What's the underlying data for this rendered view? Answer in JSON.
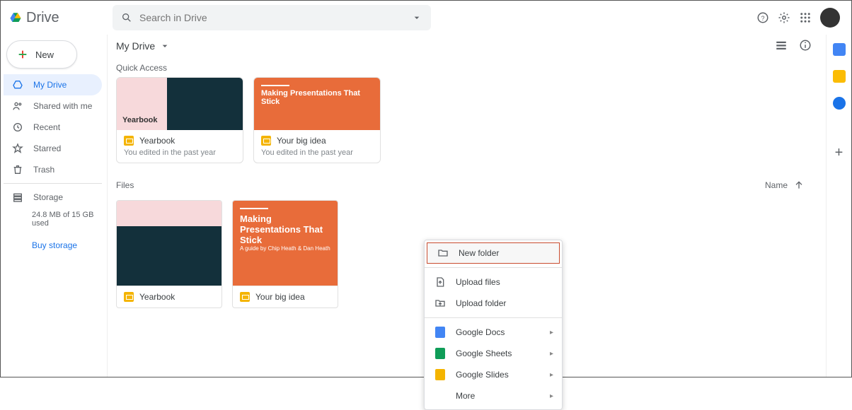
{
  "app": {
    "name": "Drive"
  },
  "search": {
    "placeholder": "Search in Drive"
  },
  "new_button": {
    "label": "New"
  },
  "sidebar": {
    "items": [
      {
        "label": "My Drive"
      },
      {
        "label": "Shared with me"
      },
      {
        "label": "Recent"
      },
      {
        "label": "Starred"
      },
      {
        "label": "Trash"
      }
    ],
    "storage": {
      "label": "Storage",
      "usage": "24.8 MB of 15 GB used",
      "buy": "Buy storage"
    }
  },
  "breadcrumb": {
    "current": "My Drive"
  },
  "quick_access": {
    "label": "Quick Access",
    "items": [
      {
        "title": "Yearbook",
        "thumb_text": "Yearbook",
        "subtitle": "You edited in the past year"
      },
      {
        "title": "Your big idea",
        "thumb_text": "Making Presentations That Stick",
        "subtitle": "You edited in the past year"
      }
    ]
  },
  "files": {
    "label": "Files",
    "sort_column": "Name",
    "items": [
      {
        "title": "Yearbook",
        "thumb_text": ""
      },
      {
        "title": "Your big idea",
        "thumb_text": "Making Presentations That Stick",
        "thumb_sub": "A guide by Chip Heath & Dan Heath"
      }
    ]
  },
  "context_menu": {
    "new_folder": "New folder",
    "upload_files": "Upload files",
    "upload_folder": "Upload folder",
    "google_docs": "Google Docs",
    "google_sheets": "Google Sheets",
    "google_slides": "Google Slides",
    "more": "More"
  }
}
